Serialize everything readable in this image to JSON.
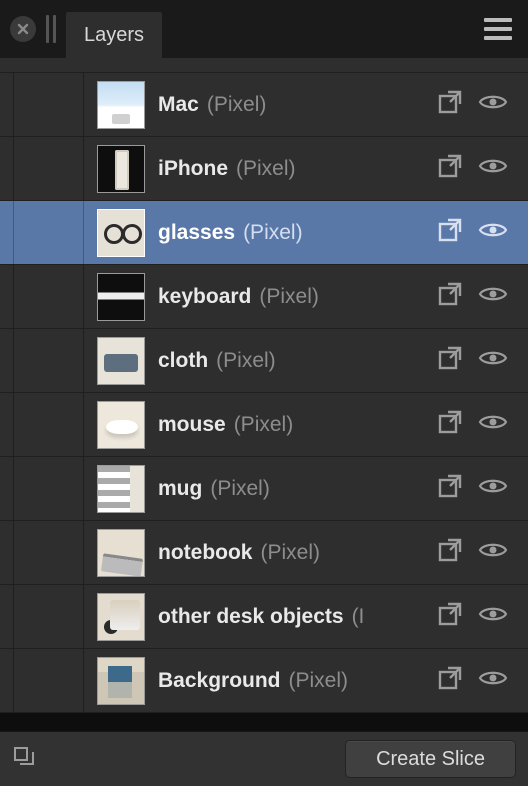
{
  "header": {
    "tab_label": "Layers"
  },
  "layers": [
    {
      "name": "Mac",
      "type": "(Pixel)",
      "selected": false,
      "thumb": "t-mac"
    },
    {
      "name": "iPhone",
      "type": "(Pixel)",
      "selected": false,
      "thumb": "t-iphone"
    },
    {
      "name": "glasses",
      "type": "(Pixel)",
      "selected": true,
      "thumb": "t-glasses"
    },
    {
      "name": "keyboard",
      "type": "(Pixel)",
      "selected": false,
      "thumb": "t-keyboard"
    },
    {
      "name": "cloth",
      "type": "(Pixel)",
      "selected": false,
      "thumb": "t-cloth"
    },
    {
      "name": "mouse",
      "type": "(Pixel)",
      "selected": false,
      "thumb": "t-mouse"
    },
    {
      "name": "mug",
      "type": "(Pixel)",
      "selected": false,
      "thumb": "t-mug"
    },
    {
      "name": "notebook",
      "type": "(Pixel)",
      "selected": false,
      "thumb": "t-notebook"
    },
    {
      "name": "other desk objects",
      "type": "(Pixel)",
      "selected": false,
      "thumb": "t-other",
      "type_truncated": "(I"
    },
    {
      "name": "Background",
      "type": "(Pixel)",
      "selected": false,
      "thumb": "t-background"
    }
  ],
  "footer": {
    "create_slice_label": "Create Slice"
  },
  "icons": {
    "close": "close-icon",
    "drag": "drag-handle-icon",
    "menu": "hamburger-menu-icon",
    "popout": "open-in-new-icon",
    "eye": "visibility-icon",
    "stack": "layer-stack-icon"
  }
}
